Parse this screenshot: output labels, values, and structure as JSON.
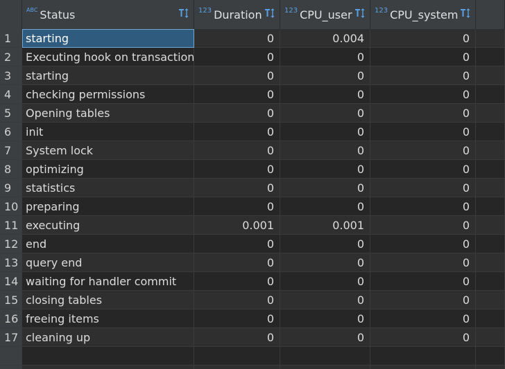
{
  "columns": {
    "status": {
      "label": "Status",
      "type_badge": "ABC",
      "type_icon": "text-type-icon"
    },
    "duration": {
      "label": "Duration",
      "type_badge": "123",
      "type_icon": "number-type-icon"
    },
    "cpu_user": {
      "label": "CPU_user",
      "type_badge": "123",
      "type_icon": "number-type-icon"
    },
    "cpu_system": {
      "label": "CPU_system",
      "type_badge": "123",
      "type_icon": "number-type-icon"
    }
  },
  "rows": [
    {
      "n": "1",
      "status": "starting",
      "duration": "0",
      "cpu_user": "0.004",
      "cpu_system": "0"
    },
    {
      "n": "2",
      "status": "Executing hook on transaction",
      "duration": "0",
      "cpu_user": "0",
      "cpu_system": "0"
    },
    {
      "n": "3",
      "status": "starting",
      "duration": "0",
      "cpu_user": "0",
      "cpu_system": "0"
    },
    {
      "n": "4",
      "status": "checking permissions",
      "duration": "0",
      "cpu_user": "0",
      "cpu_system": "0"
    },
    {
      "n": "5",
      "status": "Opening tables",
      "duration": "0",
      "cpu_user": "0",
      "cpu_system": "0"
    },
    {
      "n": "6",
      "status": "init",
      "duration": "0",
      "cpu_user": "0",
      "cpu_system": "0"
    },
    {
      "n": "7",
      "status": "System lock",
      "duration": "0",
      "cpu_user": "0",
      "cpu_system": "0"
    },
    {
      "n": "8",
      "status": "optimizing",
      "duration": "0",
      "cpu_user": "0",
      "cpu_system": "0"
    },
    {
      "n": "9",
      "status": "statistics",
      "duration": "0",
      "cpu_user": "0",
      "cpu_system": "0"
    },
    {
      "n": "10",
      "status": "preparing",
      "duration": "0",
      "cpu_user": "0",
      "cpu_system": "0"
    },
    {
      "n": "11",
      "status": "executing",
      "duration": "0.001",
      "cpu_user": "0.001",
      "cpu_system": "0"
    },
    {
      "n": "12",
      "status": "end",
      "duration": "0",
      "cpu_user": "0",
      "cpu_system": "0"
    },
    {
      "n": "13",
      "status": "query end",
      "duration": "0",
      "cpu_user": "0",
      "cpu_system": "0"
    },
    {
      "n": "14",
      "status": "waiting for handler commit",
      "duration": "0",
      "cpu_user": "0",
      "cpu_system": "0"
    },
    {
      "n": "15",
      "status": "closing tables",
      "duration": "0",
      "cpu_user": "0",
      "cpu_system": "0"
    },
    {
      "n": "16",
      "status": "freeing items",
      "duration": "0",
      "cpu_user": "0",
      "cpu_system": "0"
    },
    {
      "n": "17",
      "status": "cleaning up",
      "duration": "0",
      "cpu_user": "0",
      "cpu_system": "0"
    }
  ],
  "selection": {
    "row": "1",
    "column": "Status"
  },
  "colors": {
    "selected_cell": "#2f5b7f",
    "type_badge": "#5aa0e6",
    "sort_icon": "#5aa0e6"
  }
}
